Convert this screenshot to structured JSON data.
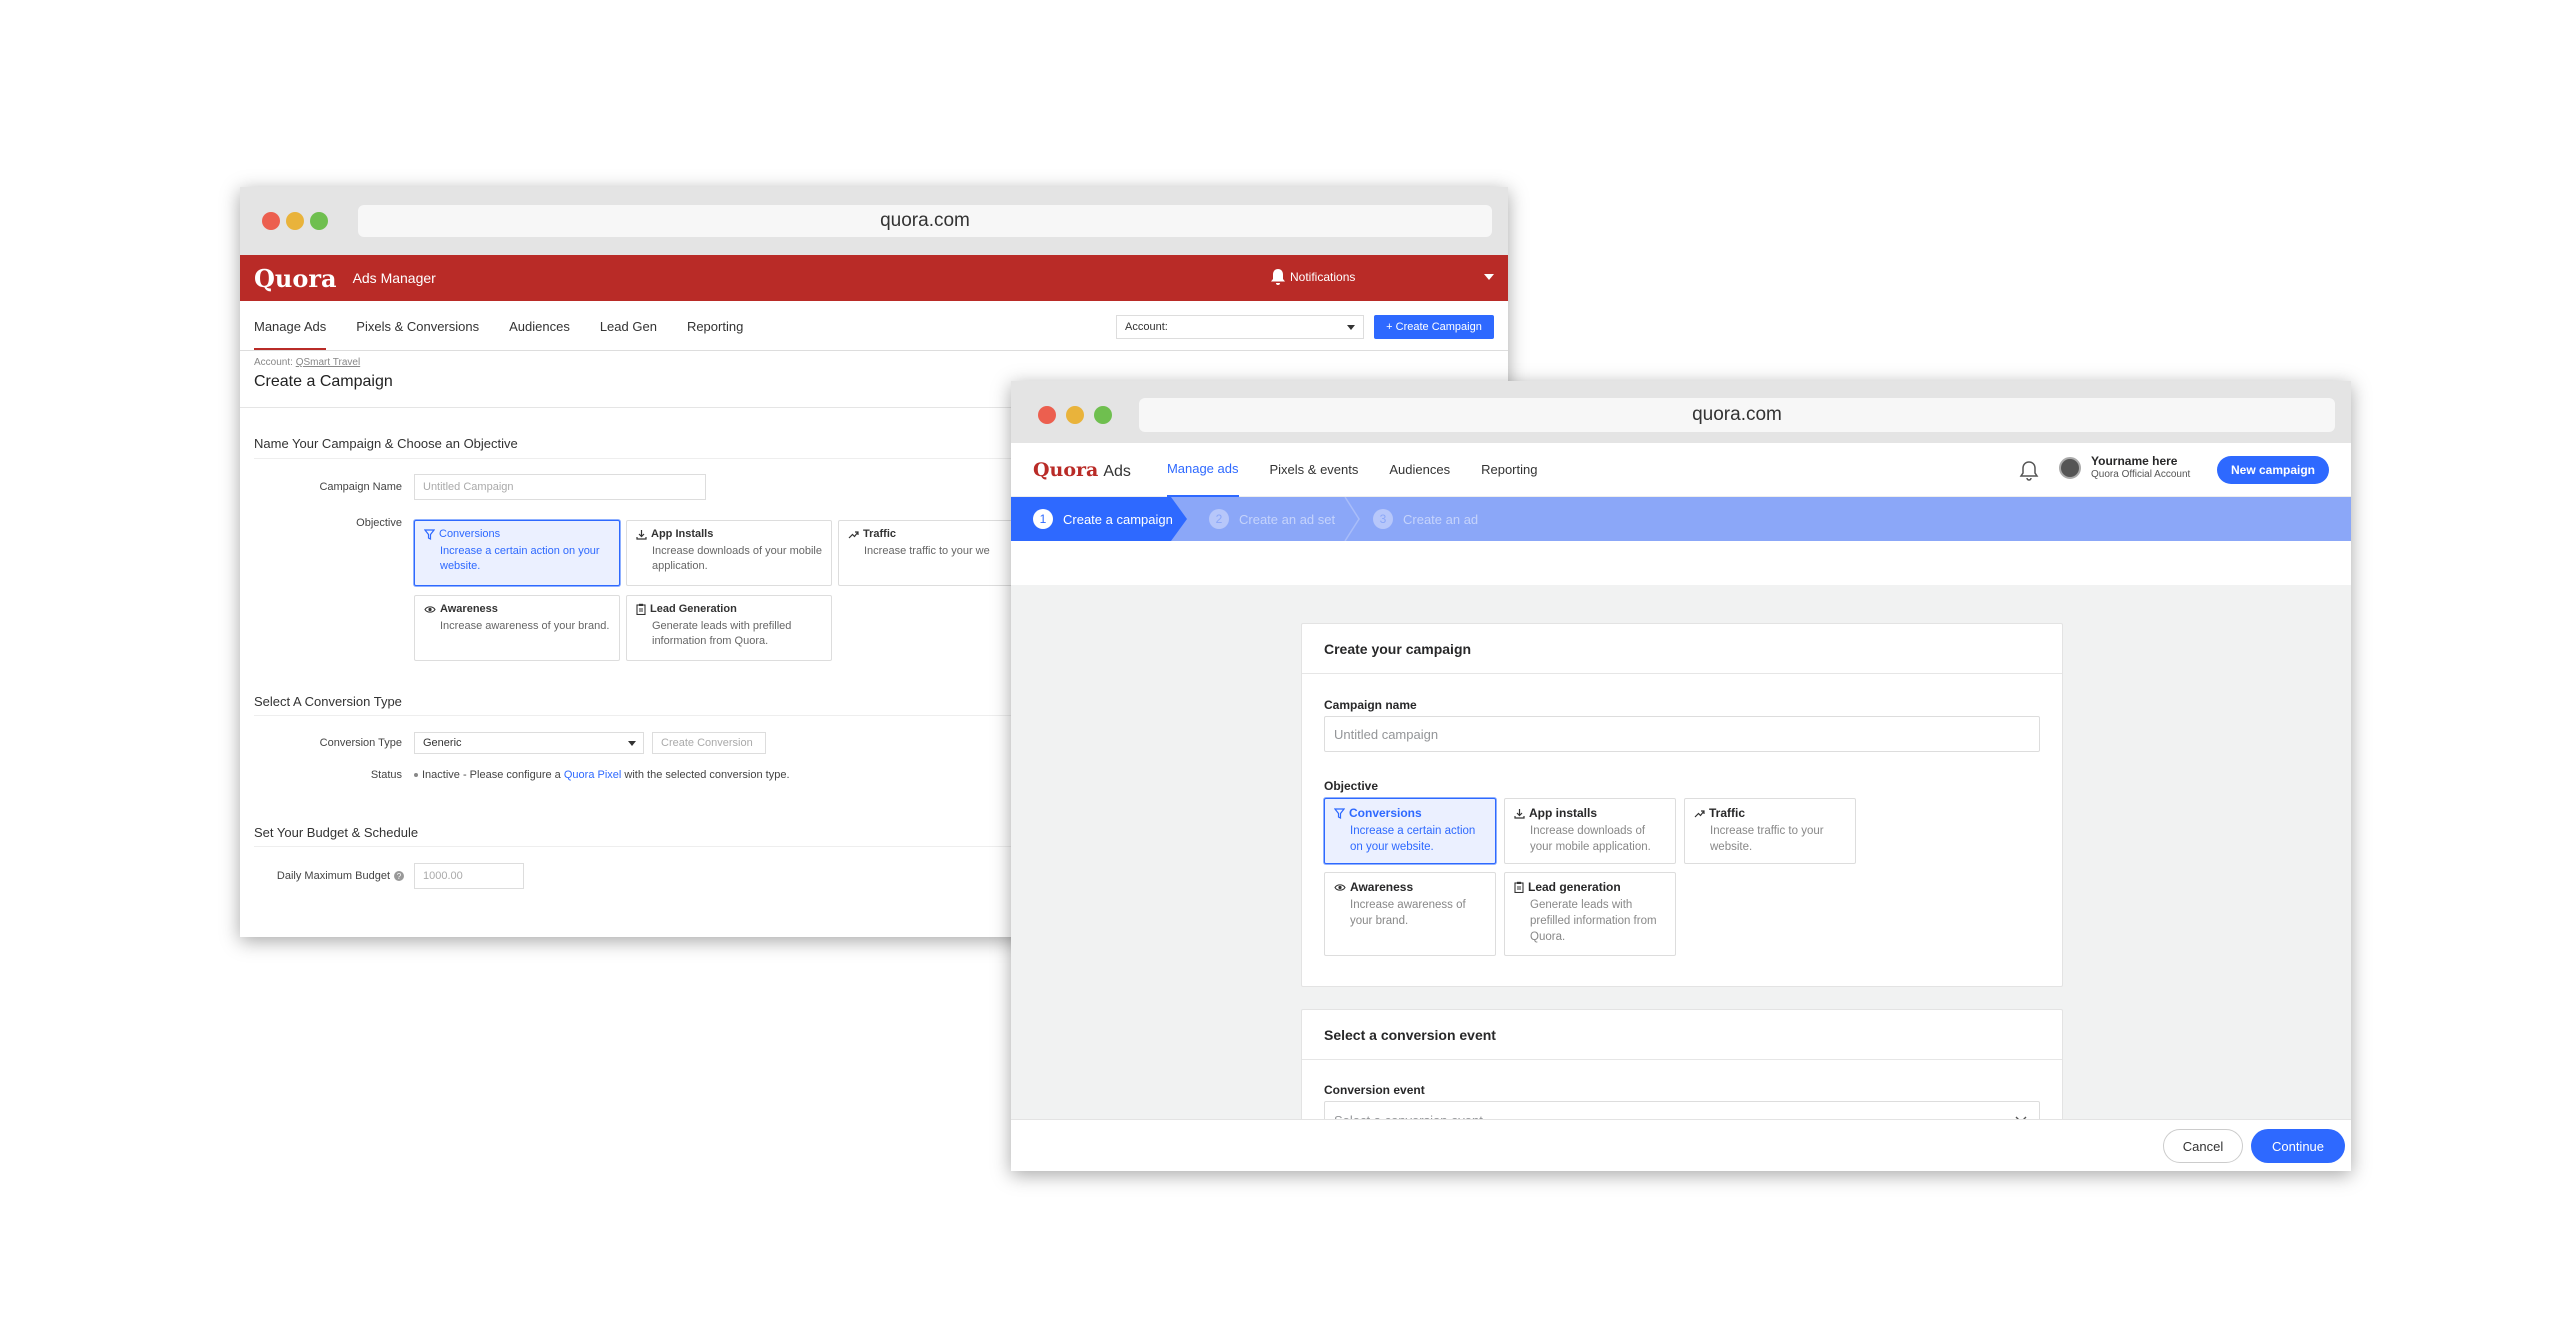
{
  "old_window": {
    "url": "quora.com",
    "brand": "Quora",
    "product": "Ads Manager",
    "notifications": "Notifications",
    "tabs": [
      "Manage Ads",
      "Pixels & Conversions",
      "Audiences",
      "Lead Gen",
      "Reporting"
    ],
    "account_label": "Account:",
    "create_btn": "+ Create Campaign",
    "account_prefix": "Account:",
    "account_name": "QSmart Travel",
    "page_title": "Create a Campaign",
    "section1": "Name Your Campaign & Choose an Objective",
    "campaign_name_label": "Campaign Name",
    "campaign_name_placeholder": "Untitled Campaign",
    "objective_label": "Objective",
    "objectives": [
      {
        "title": "Conversions",
        "desc": "Increase a certain action on your website.",
        "icon": "funnel-icon"
      },
      {
        "title": "App Installs",
        "desc": "Increase downloads of your mobile application.",
        "icon": "download-icon"
      },
      {
        "title": "Traffic",
        "desc": "Increase traffic to your we",
        "icon": "trend-icon"
      },
      {
        "title": "Awareness",
        "desc": "Increase awareness of your brand.",
        "icon": "eye-icon"
      },
      {
        "title": "Lead Generation",
        "desc": "Generate leads with prefilled information from Quora.",
        "icon": "clipboard-icon"
      }
    ],
    "section2": "Select A Conversion Type",
    "conversion_type_label": "Conversion Type",
    "conversion_type_value": "Generic",
    "create_conversion": "Create Conversion",
    "status_label": "Status",
    "status_text_1": "Inactive - Please configure a",
    "status_link": "Quora Pixel",
    "status_text_2": "with the selected conversion type.",
    "section3": "Set Your Budget & Schedule",
    "budget_label": "Daily Maximum Budget",
    "budget_placeholder": "1000.00"
  },
  "new_window": {
    "url": "quora.com",
    "brand": "Quora",
    "product": "Ads",
    "tabs": [
      "Manage ads",
      "Pixels & events",
      "Audiences",
      "Reporting"
    ],
    "user_name": "Yourname here",
    "user_account": "Quora Official Account",
    "new_campaign": "New campaign",
    "steps": [
      {
        "num": "1",
        "label": "Create a campaign"
      },
      {
        "num": "2",
        "label": "Create an ad set"
      },
      {
        "num": "3",
        "label": "Create an ad"
      }
    ],
    "panel1_title": "Create your campaign",
    "campaign_name_label": "Campaign name",
    "campaign_name_placeholder": "Untitled campaign",
    "objective_label": "Objective",
    "objectives": [
      {
        "title": "Conversions",
        "desc": "Increase a certain action on your website.",
        "icon": "funnel-icon"
      },
      {
        "title": "App installs",
        "desc": "Increase downloads of your mobile application.",
        "icon": "download-icon"
      },
      {
        "title": "Traffic",
        "desc": "Increase traffic to your website.",
        "icon": "trend-icon"
      },
      {
        "title": "Awareness",
        "desc": "Increase awareness of your brand.",
        "icon": "eye-icon"
      },
      {
        "title": "Lead generation",
        "desc": "Generate leads with prefilled information from Quora.",
        "icon": "clipboard-icon"
      }
    ],
    "panel2_title": "Select a conversion event",
    "conversion_event_label": "Conversion event",
    "conversion_event_placeholder": "Select a conversion event",
    "cancel": "Cancel",
    "continue": "Continue"
  }
}
